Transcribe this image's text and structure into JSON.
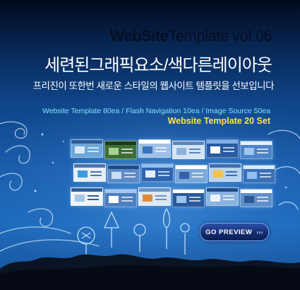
{
  "header": {
    "brand_bold": "WebSite",
    "brand_light": "Template vol.06",
    "headline": "세련된그래픽요소/색다른레이아웃",
    "subline": "프리진이 또한번 새로운 스타일의 웹사이트 템플릿을 선보입니다"
  },
  "details": {
    "spec": "Website Template 80ea / Flash Navigation 10ea / Image Source 50ea",
    "set": "Website Template 20 Set"
  },
  "cta": {
    "label": "GO PREVIEW",
    "arrows": "›››"
  },
  "colors": {
    "headline": "#ffffff",
    "spec": "#7fe3ff",
    "set": "#ffe34d",
    "button": "#142d70"
  }
}
